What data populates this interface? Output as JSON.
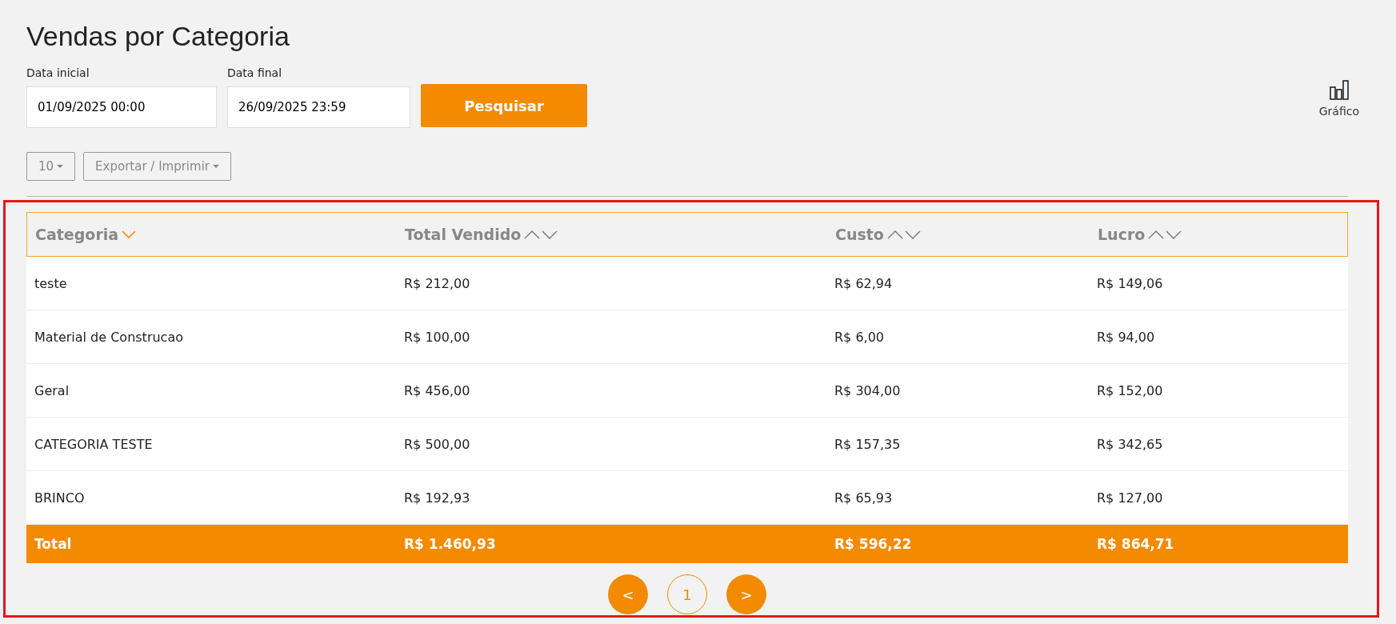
{
  "title": "Vendas por Categoria",
  "filters": [
    {
      "label": "Data inicial",
      "value": "01/09/2025 00:00"
    },
    {
      "label": "Data final",
      "value": "26/09/2025 23:59"
    }
  ],
  "search_button": "Pesquisar",
  "chart_button": "Gráfico",
  "page_size": "10",
  "export_button": "Exportar / Imprimir",
  "table": {
    "highlighted": true,
    "columns": [
      {
        "label": "Categoria",
        "sorted": true
      },
      {
        "label": "Total Vendido",
        "sorted": false
      },
      {
        "label": "Custo",
        "sorted": false
      },
      {
        "label": "Lucro",
        "sorted": false
      }
    ],
    "rows": [
      [
        "teste",
        "R$ 212,00",
        "R$ 62,94",
        "R$ 149,06"
      ],
      [
        "Material de Construcao",
        "R$ 100,00",
        "R$ 6,00",
        "R$ 94,00"
      ],
      [
        "Geral",
        "R$ 456,00",
        "R$ 304,00",
        "R$ 152,00"
      ],
      [
        "CATEGORIA TESTE",
        "R$ 500,00",
        "R$ 157,35",
        "R$ 342,65"
      ],
      [
        "BRINCO",
        "R$ 192,93",
        "R$ 65,93",
        "R$ 127,00"
      ]
    ],
    "total": [
      "Total",
      "R$ 1.460,93",
      "R$ 596,22",
      "R$ 864,71"
    ]
  },
  "pagination": {
    "prev": "<",
    "next": ">",
    "pages": [
      {
        "label": "1",
        "selected": true
      }
    ]
  }
}
